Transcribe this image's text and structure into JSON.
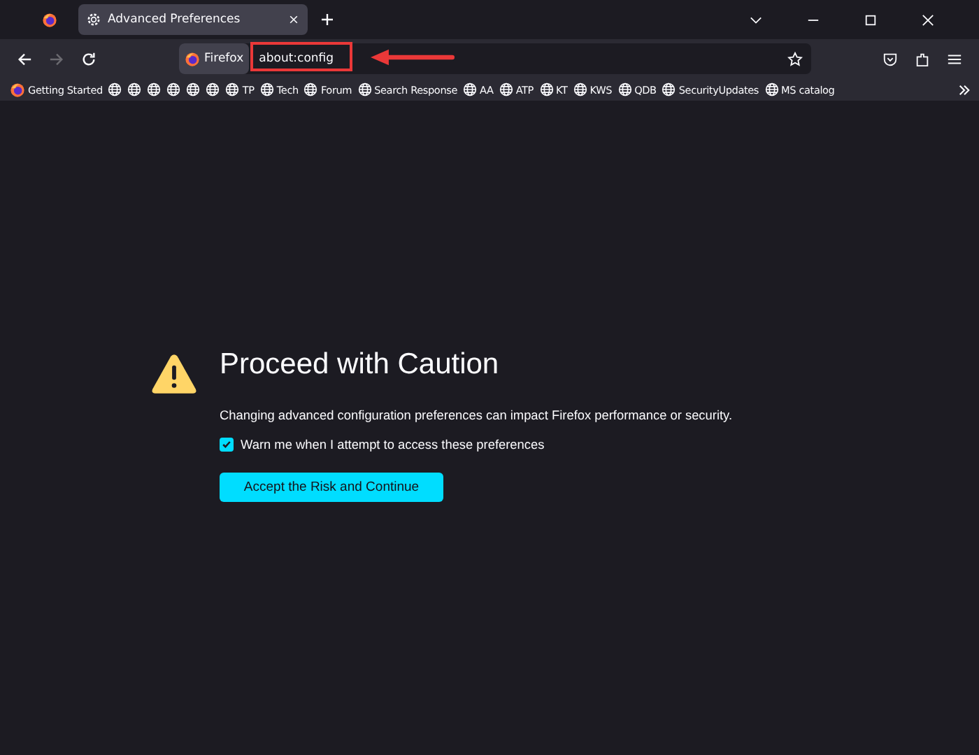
{
  "tab": {
    "title": "Advanced Preferences",
    "selected": true
  },
  "nav": {
    "identity": "Firefox",
    "url": "about:config"
  },
  "bookmarks": [
    {
      "kind": "firefox",
      "label": "Getting Started"
    },
    {
      "kind": "globe"
    },
    {
      "kind": "globe"
    },
    {
      "kind": "globe"
    },
    {
      "kind": "globe"
    },
    {
      "kind": "globe"
    },
    {
      "kind": "globe"
    },
    {
      "kind": "globe",
      "label": "TP"
    },
    {
      "kind": "globe",
      "label": "Tech"
    },
    {
      "kind": "globe",
      "label": "Forum"
    },
    {
      "kind": "globe",
      "label": "Search Response"
    },
    {
      "kind": "globe",
      "label": "AA"
    },
    {
      "kind": "globe",
      "label": "ATP"
    },
    {
      "kind": "globe",
      "label": "KT"
    },
    {
      "kind": "globe",
      "label": "KWS"
    },
    {
      "kind": "globe",
      "label": "QDB"
    },
    {
      "kind": "globe",
      "label": "SecurityUpdates"
    },
    {
      "kind": "globe",
      "label": "MS catalog"
    }
  ],
  "warning": {
    "title": "Proceed with Caution",
    "description": "Changing advanced configuration preferences can impact Firefox performance or security.",
    "checkbox": {
      "label": "Warn me when I attempt to access these preferences",
      "checked": true
    },
    "button": "Accept the Risk and Continue"
  }
}
